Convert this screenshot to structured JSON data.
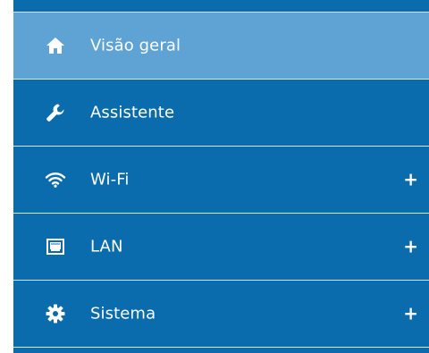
{
  "colors": {
    "menu_bg": "#0a6cad",
    "active_bg": "#5fa3d4",
    "separator": "#d5e6f2",
    "text": "#ffffff"
  },
  "menu": {
    "items": [
      {
        "label": "Visão geral",
        "icon": "home-icon",
        "active": true,
        "expandable": false
      },
      {
        "label": "Assistente",
        "icon": "wrench-icon",
        "active": false,
        "expandable": false
      },
      {
        "label": "Wi-Fi",
        "icon": "wifi-icon",
        "active": false,
        "expandable": true,
        "expander": "+"
      },
      {
        "label": "LAN",
        "icon": "lan-port-icon",
        "active": false,
        "expandable": true,
        "expander": "+"
      },
      {
        "label": "Sistema",
        "icon": "gear-icon",
        "active": false,
        "expandable": true,
        "expander": "+"
      }
    ]
  }
}
